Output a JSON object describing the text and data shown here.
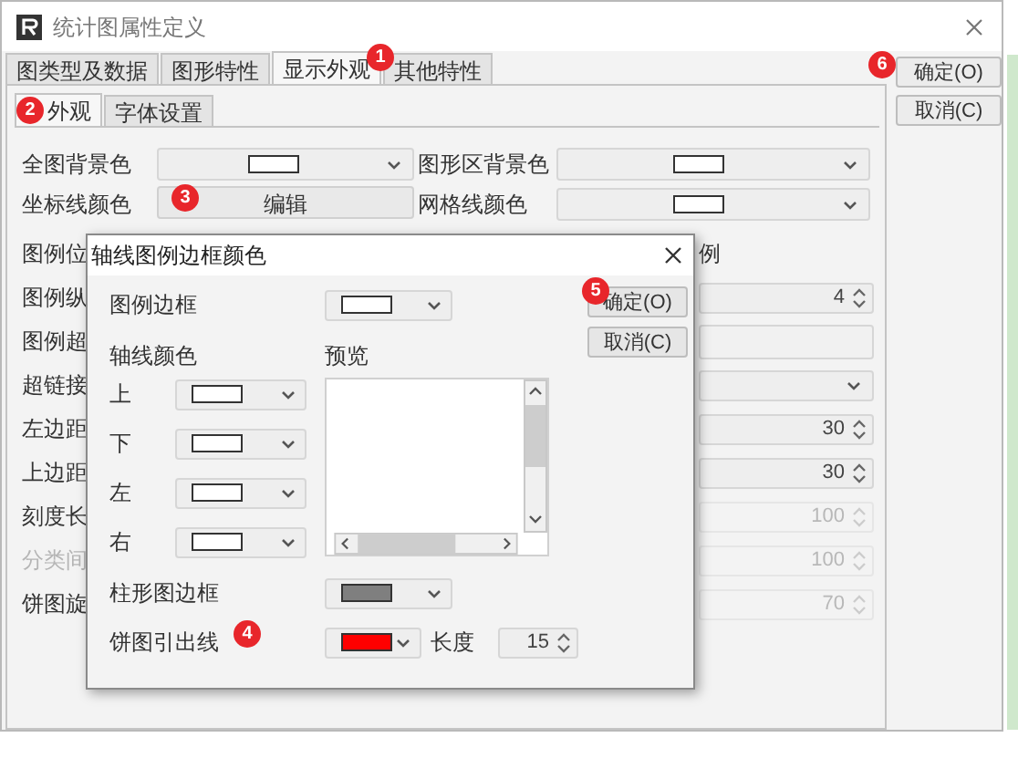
{
  "window": {
    "title": "统计图属性定义"
  },
  "tabs": [
    {
      "label": "图类型及数据",
      "selected": false
    },
    {
      "label": "图形特性",
      "selected": false
    },
    {
      "label": "显示外观",
      "selected": true,
      "marker": "1"
    },
    {
      "label": "其他特性",
      "selected": false
    }
  ],
  "subtabs": [
    {
      "label": "外观",
      "selected": true,
      "marker": "2"
    },
    {
      "label": "字体设置",
      "selected": false
    }
  ],
  "color_fields": [
    {
      "label": "全图背景色",
      "kind": "color",
      "color": "#ffffff"
    },
    {
      "label": "图形区背景色",
      "kind": "color",
      "color": "#ffffff"
    },
    {
      "label": "坐标线颜色",
      "kind": "button",
      "button": "编辑",
      "marker": "3"
    },
    {
      "label": "网格线颜色",
      "kind": "color",
      "color": "#ffffff"
    }
  ],
  "rows": [
    {
      "label": "图例位",
      "disabled": false,
      "field": {
        "kind": "label",
        "text": "例"
      }
    },
    {
      "label": "图例纵",
      "disabled": false,
      "field": {
        "kind": "spin",
        "value": "4",
        "disabled": false
      }
    },
    {
      "label": "图例超",
      "disabled": false,
      "field": {
        "kind": "text",
        "disabled": false
      }
    },
    {
      "label": "超链接",
      "disabled": false,
      "field": {
        "kind": "select",
        "disabled": false
      }
    },
    {
      "label": "左边距",
      "disabled": false,
      "field": {
        "kind": "spin",
        "value": "30",
        "disabled": false
      }
    },
    {
      "label": "上边距",
      "disabled": false,
      "field": {
        "kind": "spin",
        "value": "30",
        "disabled": false
      }
    },
    {
      "label": "刻度长",
      "disabled": false,
      "field": {
        "kind": "spin",
        "value": "100",
        "disabled": true
      }
    },
    {
      "label": "分类间",
      "disabled": true,
      "field": {
        "kind": "spin",
        "value": "100",
        "disabled": true
      }
    },
    {
      "label": "饼图旋",
      "disabled": false,
      "field": {
        "kind": "spin",
        "value": "70",
        "disabled": true
      }
    }
  ],
  "buttons": [
    {
      "label": "确定(O)",
      "marker": "6"
    },
    {
      "label": "取消(C)"
    }
  ],
  "dialog": {
    "title": "轴线图例边框颜色",
    "legend_border": {
      "label": "图例边框",
      "color": "#ffffff"
    },
    "axis_label": "轴线颜色",
    "preview_label": "预览",
    "axes": [
      {
        "label": "上",
        "color": "#ffffff"
      },
      {
        "label": "下",
        "color": "#ffffff"
      },
      {
        "label": "左",
        "color": "#ffffff"
      },
      {
        "label": "右",
        "color": "#ffffff"
      }
    ],
    "bar_border": {
      "label": "柱形图边框",
      "color": "#7f7f7f"
    },
    "pie_leader": {
      "label": "饼图引出线",
      "marker": "4",
      "color": "#ff0000",
      "length_label": "长度",
      "length": "15"
    },
    "buttons": [
      {
        "label": "确定(O)",
        "marker": "5"
      },
      {
        "label": "取消(C)"
      }
    ]
  }
}
